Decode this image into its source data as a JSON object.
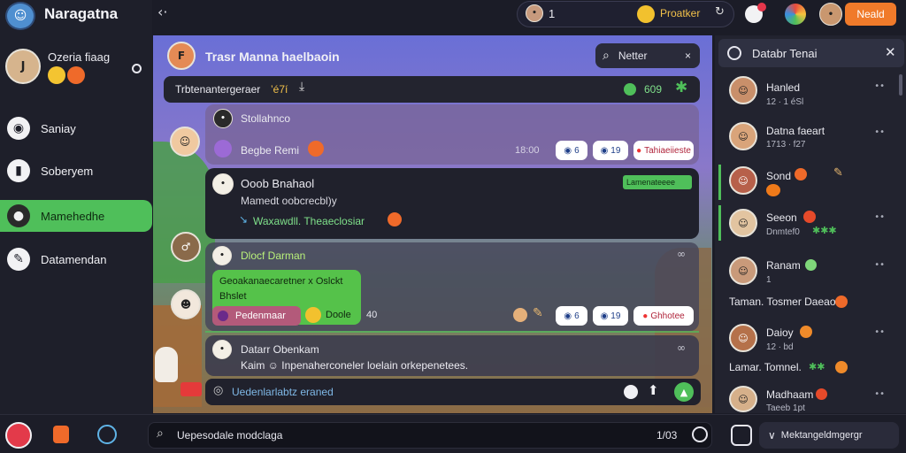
{
  "app": {
    "title": "Naragatna"
  },
  "topbar": {
    "counter": "1",
    "status_label": "Proatker",
    "profile_label": "Neald"
  },
  "sidebar": {
    "user": {
      "name": "Ozeria fiaag"
    },
    "items": [
      {
        "label": "Saniay",
        "icon": "circle-icon"
      },
      {
        "label": "Soberyem",
        "icon": "bookmark-icon"
      },
      {
        "label": "Mamehedhe",
        "icon": "user-icon"
      },
      {
        "label": "Datamendan",
        "icon": "chat-icon"
      }
    ]
  },
  "chat": {
    "channel_title": "Trasr Manna haelbaoin",
    "search_label": "Netter",
    "search_shortcut": "×",
    "pinned": {
      "text": "Trbtenantergeraer",
      "suffix": "’é7í",
      "count": "609"
    },
    "messages": [
      {
        "author": "Stollahnco",
        "line": "Begbe Remi",
        "time": "18:00",
        "reactions": [
          "6",
          "19",
          "Tahiaeiieste"
        ]
      },
      {
        "author": "Ooob Bnahaol",
        "line1": "Mamedt oobcrecbl)y",
        "line2": "Waxawdll. Theaeclosiar",
        "tag": "Lamenateeee"
      },
      {
        "author": "Dlocf Darman",
        "bubble_line1": "Geoakanaecaretner x Oslckt",
        "bubble_line2": "Bhslet",
        "chip": "Pedenmaar",
        "emoji_label": "Doole",
        "count": "40",
        "reactions": [
          "6",
          "19",
          "Ghhotee"
        ]
      },
      {
        "author": "Datarr Obenkam",
        "line": "Kaim ☺ Inpenaherconeler loelain orkepenetees."
      }
    ],
    "composer_placeholder": "Uedenlarlabtz eraned"
  },
  "right_panel": {
    "title": "Databr Tenai",
    "members": [
      {
        "name": "Hanled",
        "sub": "12 ∙ 1 éSl"
      },
      {
        "name": "Datna faeart",
        "sub": "1713 ∙ f27"
      },
      {
        "name": "Sond",
        "sub": ""
      },
      {
        "name": "Seeon",
        "sub": "Dnmtef0"
      },
      {
        "name": "Ranam",
        "sub": "1"
      },
      {
        "name": "Taman. Tosmer Daeao",
        "sub": ""
      },
      {
        "name": "Daioy",
        "sub": "12 ∙ bd"
      },
      {
        "name": "Lamar. Tomnel.",
        "sub": ""
      },
      {
        "name": "Madhaam",
        "sub": "Taeeb 1pt"
      }
    ]
  },
  "bottombar": {
    "search_placeholder": "Uepesodale modclaga",
    "time": "1/03",
    "action_label": "Mektangeldmgergr"
  },
  "colors": {
    "accent_green": "#4fbf5a",
    "orange": "#f07a2a",
    "bg": "#1b1c27",
    "panel": "#22232f"
  }
}
